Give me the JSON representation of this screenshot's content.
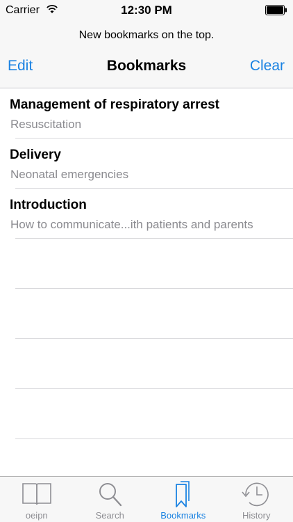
{
  "status_bar": {
    "carrier": "Carrier",
    "time": "12:30 PM"
  },
  "nav": {
    "prompt": "New bookmarks on the top.",
    "edit_label": "Edit",
    "title": "Bookmarks",
    "clear_label": "Clear"
  },
  "bookmarks": [
    {
      "title": "Management of respiratory arrest",
      "subtitle": "Resuscitation"
    },
    {
      "title": "Delivery",
      "subtitle": "Neonatal emergencies"
    },
    {
      "title": "Introduction",
      "subtitle": "How to communicate...ith patients and parents"
    }
  ],
  "tabs": [
    {
      "label": "oeipn",
      "icon": "book-icon",
      "active": false
    },
    {
      "label": "Search",
      "icon": "search-icon",
      "active": false
    },
    {
      "label": "Bookmarks",
      "icon": "bookmarks-icon",
      "active": true
    },
    {
      "label": "History",
      "icon": "history-icon",
      "active": false
    }
  ],
  "colors": {
    "accent": "#1a82e2",
    "inactive_tab": "#8e8e93",
    "subtitle": "#8a8a8f",
    "bar_background": "#f7f7f7"
  }
}
